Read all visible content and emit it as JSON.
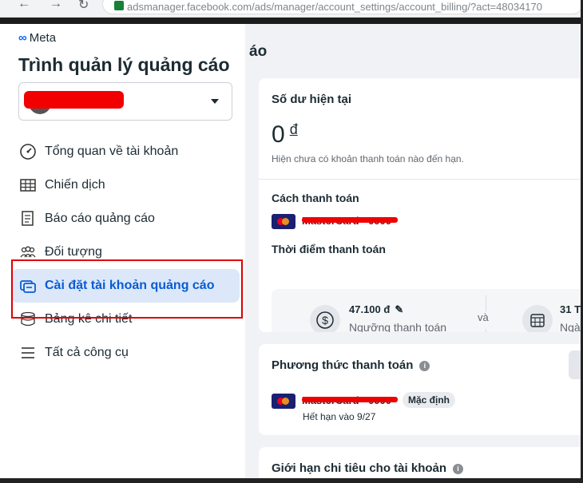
{
  "browser": {
    "url": "adsmanager.facebook.com/ads/manager/account_settings/account_billing/?act=48034170"
  },
  "sidebar": {
    "logo_text": "Meta",
    "app_title": "Trình quản lý quảng cáo",
    "items": [
      {
        "label": "Tổng quan về tài khoản",
        "icon": "dashboard-icon"
      },
      {
        "label": "Chiến dịch",
        "icon": "table-icon"
      },
      {
        "label": "Báo cáo quảng cáo",
        "icon": "report-icon"
      },
      {
        "label": "Đối tượng",
        "icon": "audience-icon"
      },
      {
        "label": "Cài đặt tài khoản quảng cáo",
        "icon": "settings-icon",
        "active": true
      },
      {
        "label": "Bảng kê chi tiết",
        "icon": "billing-icon"
      },
      {
        "label": "Tất cả công cụ",
        "icon": "menu-icon"
      }
    ]
  },
  "main": {
    "heading": "áo",
    "balance_card": {
      "title": "Số dư hiện tại",
      "amount": "0",
      "currency": "đ",
      "note": "Hiện chưa có khoản thanh toán nào đến hạn.",
      "payment_method_label": "Cách thanh toán",
      "card_number": "MasterCard · 0000",
      "timing_label": "Thời điểm thanh toán",
      "threshold_value": "47.100 đ",
      "threshold_label": "Ngưỡng thanh toán",
      "connector": "và",
      "date_value": "31 T",
      "date_label": "Ngà"
    },
    "payment_methods_card": {
      "title": "Phương thức thanh toán",
      "card_number": "MasterCard · 0000",
      "default_badge": "Mặc định",
      "expiry": "Hết hạn vào 9/27"
    },
    "spend_limit_card": {
      "title": "Giới hạn chi tiêu cho tài khoản"
    }
  }
}
